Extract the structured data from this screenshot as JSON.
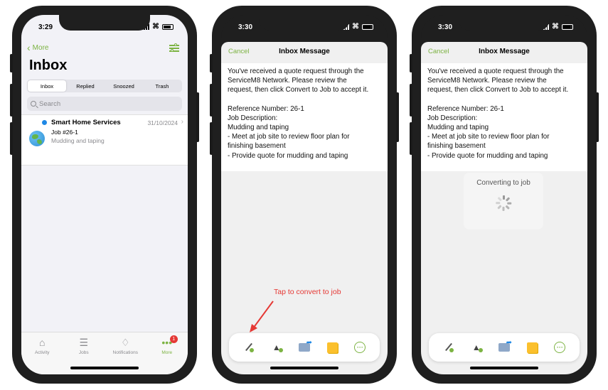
{
  "colors": {
    "accent": "#7cb342",
    "unread_dot": "#1e88e5",
    "annotation": "#e53935",
    "badge": "#e53935"
  },
  "phone1": {
    "time": "3:29",
    "back_label": "More",
    "title": "Inbox",
    "segments": [
      "Inbox",
      "Replied",
      "Snoozed",
      "Trash"
    ],
    "active_segment": "Inbox",
    "search_placeholder": "Search",
    "message": {
      "sender": "Smart Home Services",
      "date": "31/10/2024",
      "job": "Job #26-1",
      "preview": "Mudding and taping",
      "unread": true
    },
    "tabs": [
      {
        "label": "Activity",
        "icon": "home-icon"
      },
      {
        "label": "Jobs",
        "icon": "list-icon"
      },
      {
        "label": "Notifications",
        "icon": "bell-icon"
      },
      {
        "label": "More",
        "icon": "more-dots-icon",
        "badge": "1",
        "active": true
      }
    ]
  },
  "message_sheet": {
    "cancel_label": "Cancel",
    "title": "Inbox Message",
    "body_lines": [
      "You've received a quote request through the",
      "ServiceM8 Network. Please review the",
      "request, then click Convert to Job to accept it.",
      "",
      "Reference Number: 26-1",
      "Job Description:",
      "Mudding and taping",
      "- Meet at job site to review floor plan for",
      "finishing basement",
      "- Provide quote for mudding and taping"
    ],
    "toolbar": [
      "convert-to-job-icon",
      "forward-icon",
      "reply-icon",
      "note-icon",
      "more-icon"
    ]
  },
  "phone2": {
    "time": "3:30",
    "annotation": "Tap to convert to job"
  },
  "phone3": {
    "time": "3:30",
    "converting_label": "Converting to job"
  }
}
